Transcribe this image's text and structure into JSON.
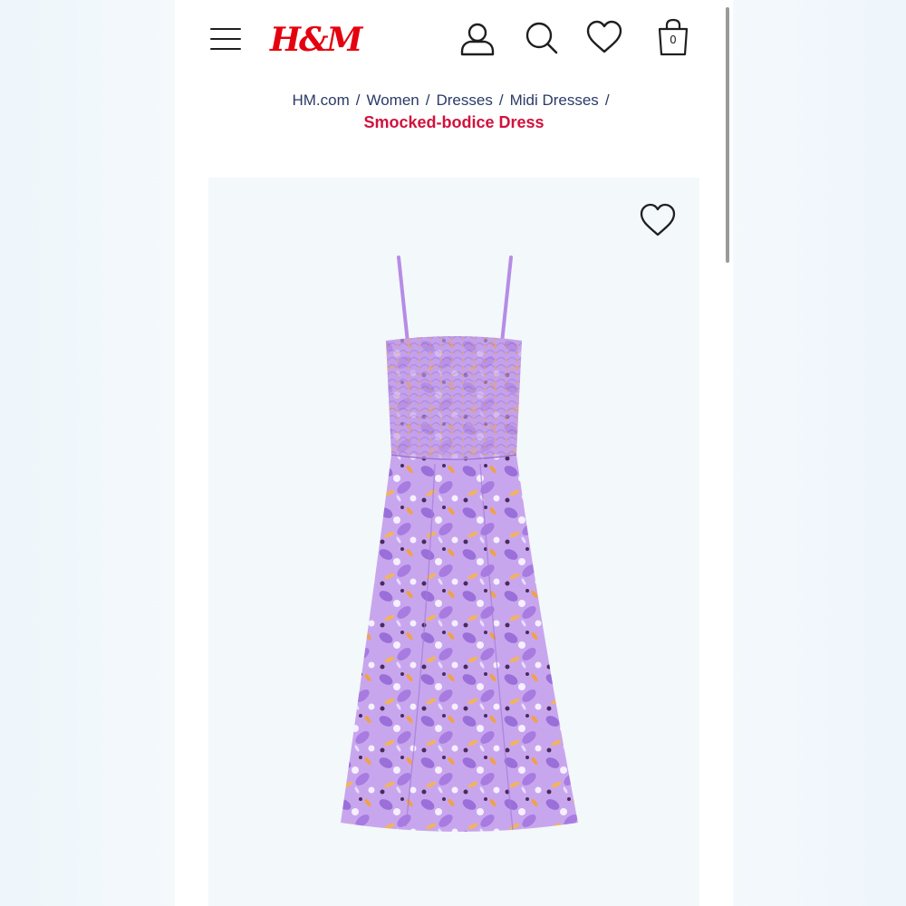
{
  "header": {
    "logo_text": "H&M",
    "cart_count": "0",
    "icons": [
      "menu-icon",
      "account-icon",
      "search-icon",
      "heart-icon",
      "bag-icon"
    ]
  },
  "breadcrumb": {
    "items": [
      "HM.com",
      "Women",
      "Dresses",
      "Midi Dresses"
    ],
    "separator": "/",
    "current": "Smocked-bodice Dress"
  },
  "product": {
    "favorite_icon": "heart-outline-icon"
  },
  "colors": {
    "brand_red": "#e50010",
    "title_pink": "#d0123e",
    "link_navy": "#2b3a67",
    "dress_lilac": "#b48ae6"
  }
}
